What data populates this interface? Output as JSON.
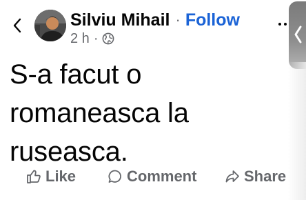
{
  "header": {
    "author_name": "Silviu Mihail",
    "separator": "·",
    "follow_label": "Follow",
    "timestamp": "2 h",
    "meta_separator": "·",
    "privacy_icon": "globe-icon",
    "more_icon": "more-dots-icon",
    "back_icon": "chevron-left-icon"
  },
  "post": {
    "line1": "S-a facut o",
    "line2": "romaneasca la",
    "line3": "ruseasca."
  },
  "actions": {
    "like_label": "Like",
    "comment_label": "Comment",
    "share_label": "Share"
  },
  "colors": {
    "follow": "#1b63d6",
    "secondary_text": "#65676b",
    "primary_text": "#050505"
  }
}
